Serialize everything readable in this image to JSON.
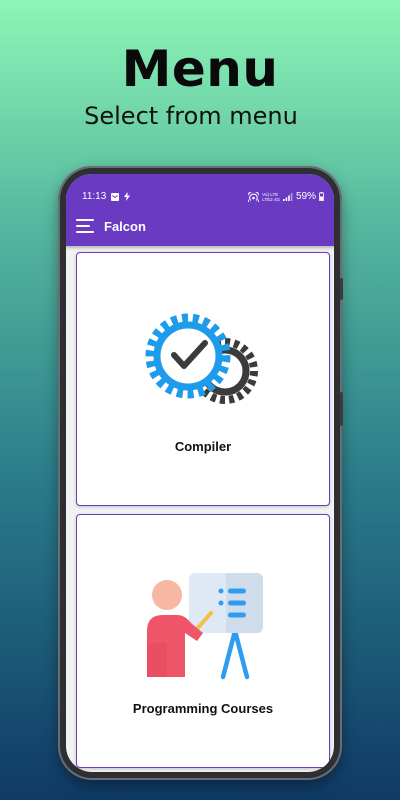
{
  "hero": {
    "title": "Menu",
    "subtitle": "Select from menu"
  },
  "status_bar": {
    "time": "11:13",
    "battery": "59%",
    "net_top": "Vo) LTE",
    "net_bottom": "LTE2 4G"
  },
  "app_bar": {
    "title": "Falcon",
    "menu_icon": "hamburger-menu-icon"
  },
  "menu_cards": [
    {
      "label": "Compiler",
      "icon": "gears-check-icon"
    },
    {
      "label": "Programming Courses",
      "icon": "presentation-teacher-icon"
    }
  ],
  "colors": {
    "primary": "#6a3bc2",
    "gear_blue": "#1e9bea",
    "gear_dark": "#3b3b3b"
  }
}
